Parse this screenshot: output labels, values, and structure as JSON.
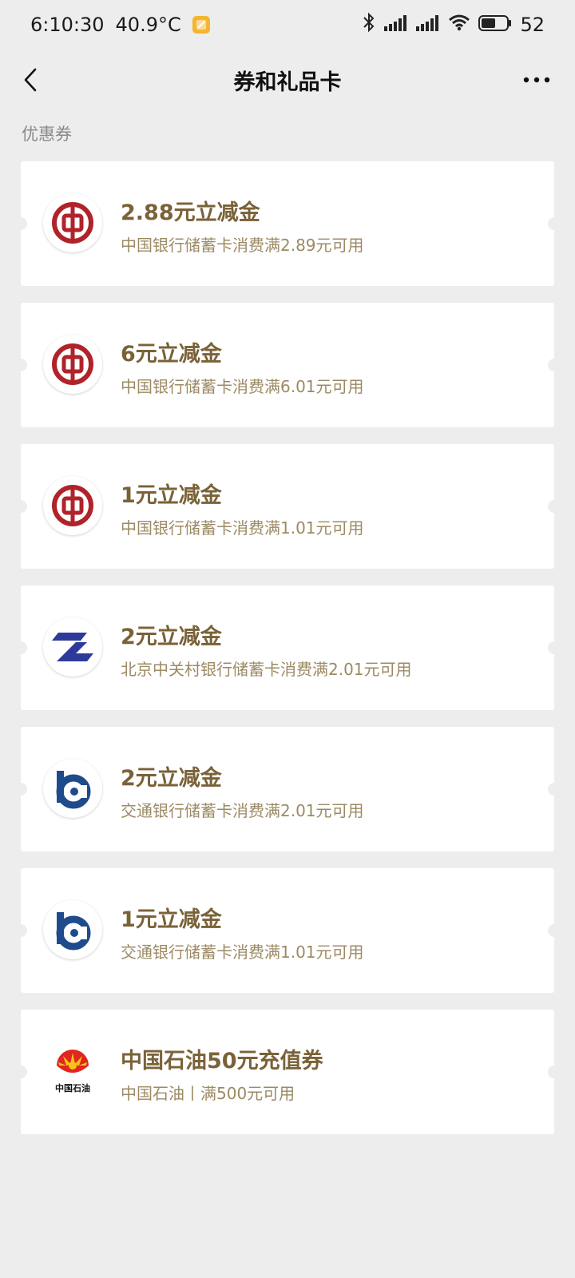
{
  "status_bar": {
    "time": "6:10:30",
    "temperature": "40.9°C",
    "battery": "52"
  },
  "nav": {
    "title": "券和礼品卡"
  },
  "section": {
    "label": "优惠券"
  },
  "coupons": [
    {
      "title": "2.88元立减金",
      "desc": "中国银行储蓄卡消费满2.89元可用",
      "logo": "bank-of-china-icon"
    },
    {
      "title": "6元立减金",
      "desc": "中国银行储蓄卡消费满6.01元可用",
      "logo": "bank-of-china-icon"
    },
    {
      "title": "1元立减金",
      "desc": "中国银行储蓄卡消费满1.01元可用",
      "logo": "bank-of-china-icon"
    },
    {
      "title": "2元立减金",
      "desc": "北京中关村银行储蓄卡消费满2.01元可用",
      "logo": "zhongguancun-bank-icon"
    },
    {
      "title": "2元立减金",
      "desc": "交通银行储蓄卡消费满2.01元可用",
      "logo": "bank-of-communications-icon"
    },
    {
      "title": "1元立减金",
      "desc": "交通银行储蓄卡消费满1.01元可用",
      "logo": "bank-of-communications-icon"
    },
    {
      "title": "中国石油50元充值券",
      "desc": "中国石油丨满500元可用",
      "logo": "petrochina-icon",
      "logo_text": "中国石油"
    }
  ],
  "colors": {
    "background": "#ededed",
    "coupon_title": "#7a6238",
    "coupon_desc": "#9c8a64",
    "boc_red": "#b0232a",
    "zgc_blue": "#2e3a9a",
    "bocom_blue": "#1f4a8c"
  }
}
